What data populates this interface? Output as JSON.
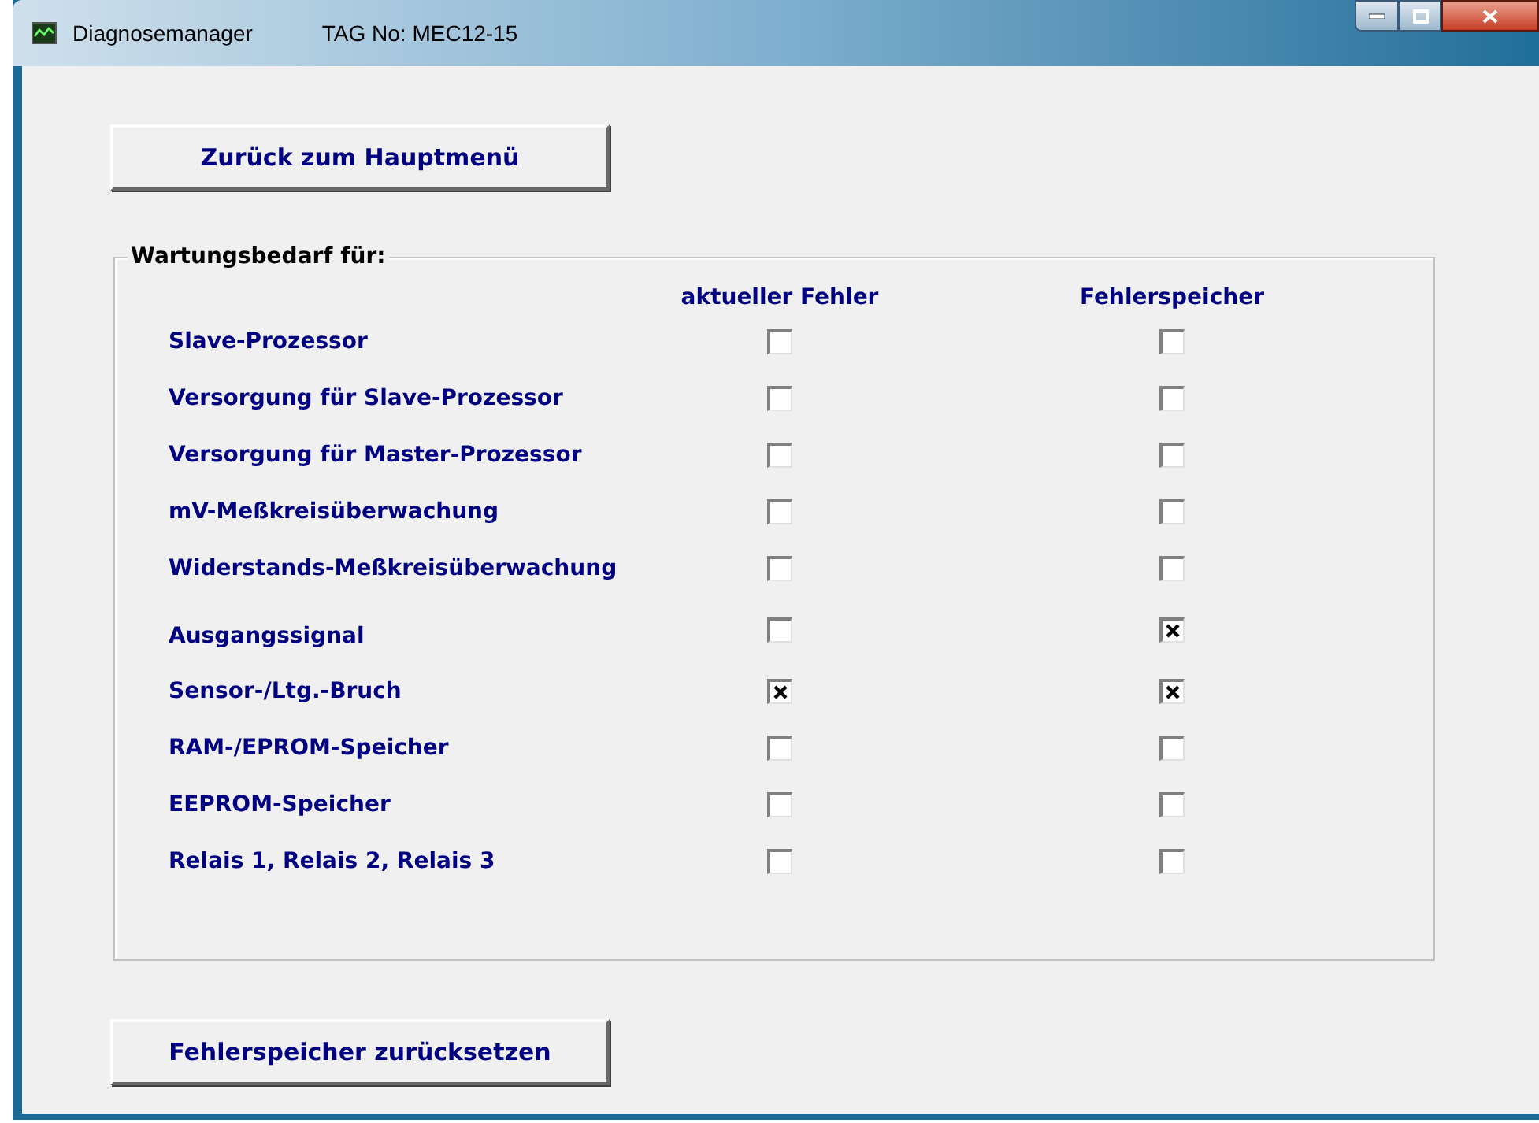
{
  "window": {
    "title": "Diagnosemanager",
    "tag": "TAG No: MEC12-15"
  },
  "back_button": "Zurück zum Hauptmenü",
  "group": {
    "title": "Wartungsbedarf für:",
    "columns": [
      "aktueller Fehler",
      "Fehlerspeicher"
    ],
    "rows": [
      {
        "label": "Slave-Prozessor",
        "current": false,
        "stored": false
      },
      {
        "label": "Versorgung für Slave-Prozessor",
        "current": false,
        "stored": false
      },
      {
        "label": "Versorgung für Master-Prozessor",
        "current": false,
        "stored": false
      },
      {
        "label": "mV-Meßkreisüberwachung",
        "current": false,
        "stored": false
      },
      {
        "label": "Widerstands-Meßkreisüberwachung",
        "current": false,
        "stored": false
      },
      {
        "label": "Ausgangssignal",
        "current": false,
        "stored": true
      },
      {
        "label": "Sensor-/Ltg.-Bruch",
        "current": true,
        "stored": true
      },
      {
        "label": "RAM-/EPROM-Speicher",
        "current": false,
        "stored": false
      },
      {
        "label": "EEPROM-Speicher",
        "current": false,
        "stored": false
      },
      {
        "label": "Relais 1, Relais 2, Relais 3",
        "current": false,
        "stored": false
      }
    ]
  },
  "reset_button": "Fehlerspeicher zurücksetzen"
}
